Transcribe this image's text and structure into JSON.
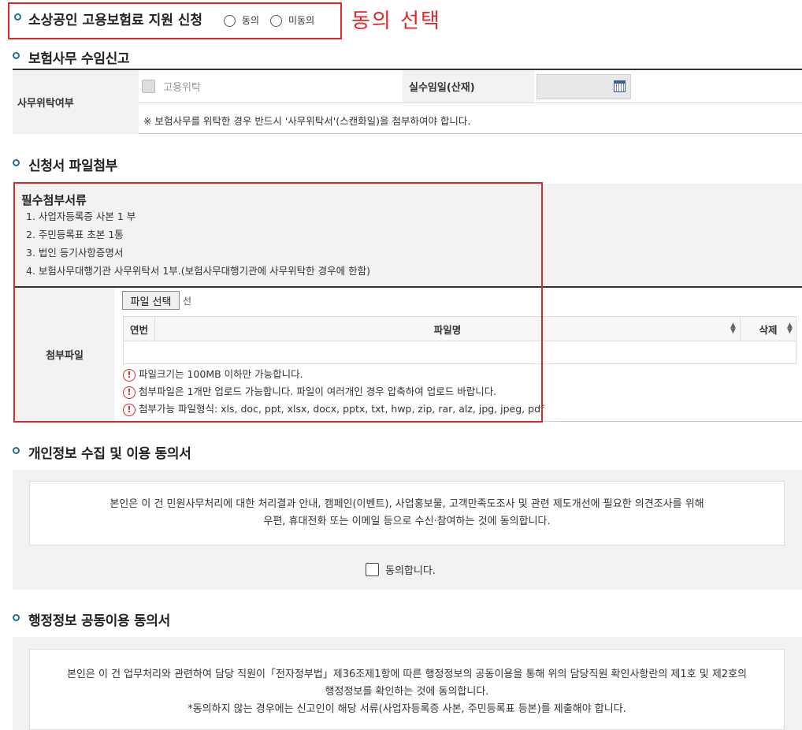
{
  "consent_select": {
    "title": "소상공인 고용보험료 지원 신청",
    "option_agree": "동의",
    "option_disagree": "미동의",
    "annotation": "동의 선택",
    "annotation_color": "#e0262b"
  },
  "insurance": {
    "section_title": "보험사무 수임신고",
    "row_header": "사무위탁여부",
    "checkbox_label": "고용위탁",
    "date_header": "실수임일(산재)",
    "date_value": "",
    "note": "※ 보험사무를 위탁한 경우 반드시 '사무위탁서'(스캔화일)을 첨부하여야 합니다."
  },
  "attachments": {
    "section_title": "신청서 파일첨부",
    "required_title": "필수첨부서류",
    "required_items": [
      "1. 사업자등록증 사본 1 부",
      "2. 주민등록표 초본 1통",
      "3. 법인 등기사항증명서",
      "4. 보험사무대행기관 사무위탁서 1부.(보험사무대행기관에 사무위탁한 경우에 한함)"
    ],
    "row_header": "첨부파일",
    "file_button": "파일 선택",
    "file_status": "선",
    "columns": [
      "연번",
      "파일명",
      "삭제"
    ],
    "warnings": [
      "파일크기는 100MB 이하만 가능합니다.",
      "첨부파일은 1개만 업로드 가능합니다. 파일이 여러개인 경우 압축하여 업로드 바랍니다.",
      "첨부가능 파일형식: xls, doc, ppt, xlsx, docx, pptx, txt, hwp, zip, rar, alz, jpg, jpeg, pdf"
    ],
    "warning_icon": "!"
  },
  "privacy": {
    "section_title": "개인정보 수집 및 이용 동의서",
    "line1": "본인은 이 건 민원사무처리에 대한 처리결과 안내, 캠페인(이벤트), 사업홍보물, 고객만족도조사 및 관련 제도개선에 필요한 의견조사를 위해",
    "line2": "우편, 휴대전화 또는 이메일 등으로 수신·참여하는 것에 동의합니다.",
    "agree_label": "동의합니다."
  },
  "admin_info": {
    "section_title": "행정정보 공동이용 동의서",
    "line1": "본인은 이 건 업무처리와 관련하여 담당 직원이「전자정부법」제36조제1항에 따른 행정정보의 공동이용을 통해 위의 담당직원 확인사항란의 제1호 및 제2호의",
    "line2": "행정정보를 확인하는 것에 동의합니다.",
    "line3": "*동의하지 않는 경우에는 신고인이 해당 서류(사업자등록증 사본, 주민등록표 등본)를 제출해야 합니다."
  },
  "colors": {
    "accent": "#1f6f84",
    "highlight": "#e0262b",
    "panel_bg": "#f2f2f2"
  }
}
